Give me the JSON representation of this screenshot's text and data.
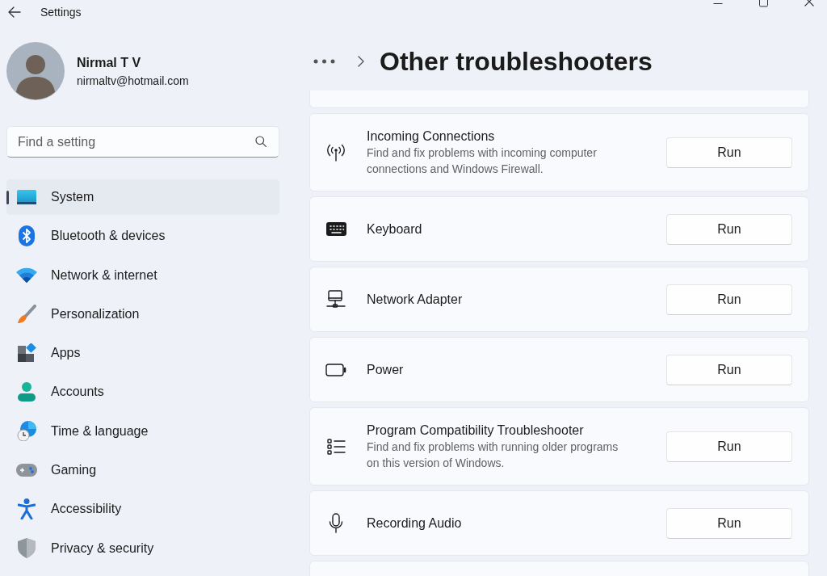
{
  "window": {
    "title": "Settings"
  },
  "profile": {
    "name": "Nirmal T V",
    "email": "nirmaltv@hotmail.com"
  },
  "search": {
    "placeholder": "Find a setting"
  },
  "sidebar": {
    "items": [
      {
        "label": "System",
        "selected": true
      },
      {
        "label": "Bluetooth & devices",
        "selected": false
      },
      {
        "label": "Network & internet",
        "selected": false
      },
      {
        "label": "Personalization",
        "selected": false
      },
      {
        "label": "Apps",
        "selected": false
      },
      {
        "label": "Accounts",
        "selected": false
      },
      {
        "label": "Time & language",
        "selected": false
      },
      {
        "label": "Gaming",
        "selected": false
      },
      {
        "label": "Accessibility",
        "selected": false
      },
      {
        "label": "Privacy & security",
        "selected": false
      }
    ]
  },
  "page": {
    "title": "Other troubleshooters"
  },
  "troubleshooters": [
    {
      "title": "Incoming Connections",
      "description": "Find and fix problems with incoming computer connections and Windows Firewall.",
      "button": "Run"
    },
    {
      "title": "Keyboard",
      "button": "Run"
    },
    {
      "title": "Network Adapter",
      "button": "Run"
    },
    {
      "title": "Power",
      "button": "Run"
    },
    {
      "title": "Program Compatibility Troubleshooter",
      "description": "Find and fix problems with running older programs on this version of Windows.",
      "button": "Run"
    },
    {
      "title": "Recording Audio",
      "button": "Run"
    }
  ]
}
